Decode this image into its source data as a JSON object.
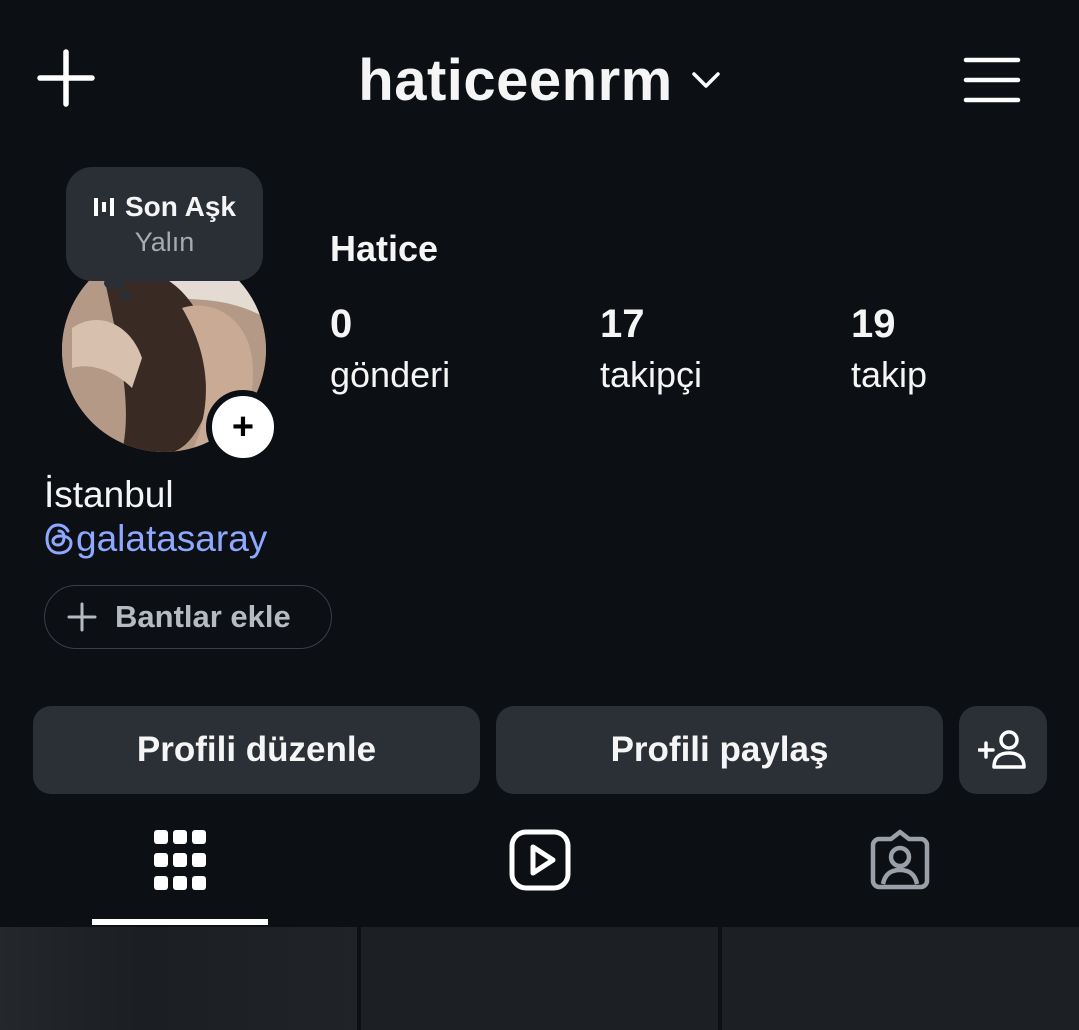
{
  "header": {
    "username": "haticeenrm",
    "create_icon": "plus-icon",
    "menu_icon": "hamburger-menu-icon",
    "switch_account_icon": "chevron-down-icon"
  },
  "profile": {
    "music": {
      "title": "Son Aşk",
      "artist": "Yalın",
      "icon": "music-bars-icon"
    },
    "full_name": "Hatice",
    "stats": [
      {
        "value": "0",
        "label": "gönderi"
      },
      {
        "value": "17",
        "label": "takipçi"
      },
      {
        "value": "19",
        "label": "takip"
      }
    ],
    "bio_location": "İstanbul",
    "threads_handle": "galatasaray",
    "bands_button": "Bantlar ekle"
  },
  "actions": {
    "edit_profile": "Profili düzenle",
    "share_profile": "Profili paylaş",
    "discover_people_icon": "add-person-icon"
  },
  "tabs": [
    {
      "name": "posts",
      "icon": "grid-icon",
      "active": true
    },
    {
      "name": "reels",
      "icon": "reels-icon",
      "active": false
    },
    {
      "name": "tagged",
      "icon": "tagged-person-icon",
      "active": false
    }
  ],
  "colors": {
    "background": "#0c0f14",
    "button": "#2b2f36",
    "link": "#8fa8ff",
    "muted_text": "#a6aab2"
  }
}
